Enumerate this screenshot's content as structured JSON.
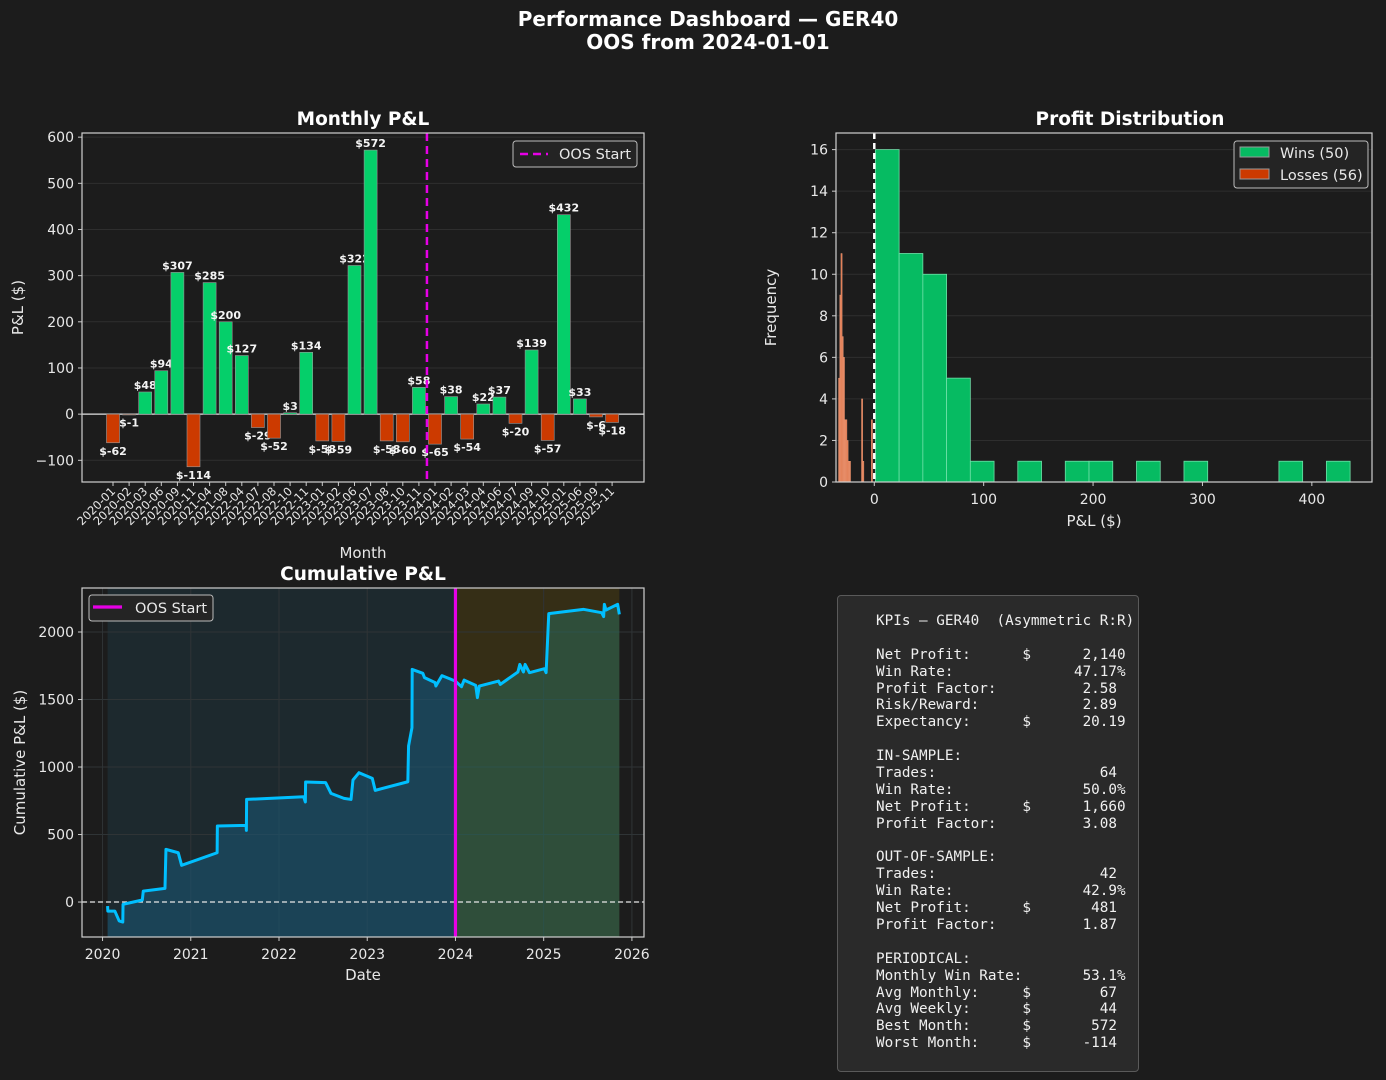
{
  "title": "Performance Dashboard — GER40",
  "subtitle": "OOS from 2024-01-01",
  "colors": {
    "background": "#1c1c1c",
    "win": "#05cf6a",
    "loss": "#cc3a00",
    "win_hist": "#06bb62",
    "loss_hist": "#e07a50",
    "oos": "#e600e6",
    "equity": "#00bfff"
  },
  "chart_data": [
    {
      "type": "bar",
      "title": "Monthly P&L",
      "xlabel": "Month",
      "ylabel": "P&L ($)",
      "ylim": [
        -147,
        609
      ],
      "yticks": [
        -100,
        0,
        100,
        200,
        300,
        400,
        500,
        600
      ],
      "categories": [
        "2020-01",
        "2020-02",
        "2020-03",
        "2020-06",
        "2020-09",
        "2020-11",
        "2021-04",
        "2021-08",
        "2022-04",
        "2022-07",
        "2022-08",
        "2022-10",
        "2022-11",
        "2023-01",
        "2023-02",
        "2023-06",
        "2023-07",
        "2023-08",
        "2023-10",
        "2023-11",
        "2024-01",
        "2024-02",
        "2024-03",
        "2024-04",
        "2024-06",
        "2024-07",
        "2024-09",
        "2024-10",
        "2025-01",
        "2025-06",
        "2025-09",
        "2025-11"
      ],
      "values": [
        -62,
        -1,
        48,
        94,
        307,
        -114,
        285,
        200,
        127,
        -29,
        -52,
        3,
        134,
        -58,
        -59,
        322,
        572,
        -58,
        -60,
        58,
        -65,
        38,
        -54,
        22,
        37,
        -20,
        139,
        -57,
        432,
        33,
        -6,
        -18
      ],
      "labels": [
        "$-62",
        "$-1",
        "$48",
        "$94",
        "$307",
        "$-114",
        "$285",
        "$200",
        "$127",
        "$-29",
        "$-52",
        "$3",
        "$134",
        "$-58",
        "$-59",
        "$322",
        "$572",
        "$-58",
        "$-60",
        "$58",
        "$-65",
        "$38",
        "$-54",
        "$22",
        "$37",
        "$-20",
        "$139",
        "$-57",
        "$432",
        "$33",
        "$-6",
        "$-18"
      ],
      "oos_start_between": [
        "2023-11",
        "2024-01"
      ],
      "legend": {
        "entries": [
          "OOS Start"
        ],
        "placement": "upper right"
      },
      "grid": true
    },
    {
      "type": "histogram",
      "title": "Profit Distribution",
      "xlabel": "P&L ($)",
      "ylabel": "Frequency",
      "xlim": [
        -35,
        455
      ],
      "ylim": [
        0,
        16.8
      ],
      "xticks": [
        0,
        100,
        200,
        300,
        400
      ],
      "yticks": [
        0,
        2,
        4,
        6,
        8,
        10,
        12,
        14,
        16
      ],
      "series": [
        {
          "name": "Wins (50)",
          "bin_width": 21.7,
          "bins": [
            [
              1,
              16
            ],
            [
              22.7,
              11
            ],
            [
              44.4,
              10
            ],
            [
              66.1,
              5
            ],
            [
              87.8,
              1
            ],
            [
              131.2,
              1
            ],
            [
              174.6,
              1
            ],
            [
              196.3,
              1
            ],
            [
              239.7,
              1
            ],
            [
              283.1,
              1
            ],
            [
              369.9,
              1
            ],
            [
              413.3,
              1
            ]
          ]
        },
        {
          "name": "Losses (56)",
          "bin_width": 1.1,
          "bins": [
            [
              -32.7,
              5
            ],
            [
              -31.6,
              9
            ],
            [
              -30.5,
              11
            ],
            [
              -29.4,
              7
            ],
            [
              -28.3,
              6
            ],
            [
              -27.2,
              3
            ],
            [
              -26.1,
              3
            ],
            [
              -25.0,
              2
            ],
            [
              -23.9,
              1
            ],
            [
              -22.8,
              1
            ],
            [
              -11.7,
              4
            ],
            [
              -10.6,
              1
            ],
            [
              -2.7,
              3
            ]
          ]
        }
      ],
      "zero_line": 0,
      "legend": {
        "placement": "upper right"
      },
      "grid": true
    },
    {
      "type": "line",
      "title": "Cumulative P&L",
      "xlabel": "Date",
      "ylabel": "Cumulative P&L ($)",
      "xlim": [
        "2019-10-08",
        "2026-02-20"
      ],
      "ylim": [
        -259,
        2326
      ],
      "xticks": [
        "2020",
        "2021",
        "2022",
        "2023",
        "2024",
        "2025",
        "2026"
      ],
      "yticks": [
        0,
        500,
        1000,
        1500,
        2000
      ],
      "oos_start": "2024-01-01",
      "legend": {
        "entries": [
          "OOS Start"
        ],
        "placement": "upper left"
      },
      "points": [
        [
          "2020-01-22",
          -30
        ],
        [
          "2020-01-23",
          -67
        ],
        [
          "2020-02-21",
          -67
        ],
        [
          "2020-03-10",
          -140
        ],
        [
          "2020-03-25",
          -148
        ],
        [
          "2020-03-26",
          -17
        ],
        [
          "2020-06-14",
          15
        ],
        [
          "2020-06-18",
          81
        ],
        [
          "2020-09-16",
          101
        ],
        [
          "2020-09-20",
          390
        ],
        [
          "2020-11-10",
          365
        ],
        [
          "2020-11-24",
          272
        ],
        [
          "2021-04-20",
          365
        ],
        [
          "2021-04-21",
          563
        ],
        [
          "2021-08-18",
          568
        ],
        [
          "2021-08-19",
          531
        ],
        [
          "2021-08-20",
          760
        ],
        [
          "2022-04-13",
          780
        ],
        [
          "2022-04-20",
          741
        ],
        [
          "2022-04-21",
          889
        ],
        [
          "2022-07-13",
          884
        ],
        [
          "2022-08-04",
          805
        ],
        [
          "2022-09-27",
          768
        ],
        [
          "2022-10-26",
          760
        ],
        [
          "2022-11-03",
          904
        ],
        [
          "2022-11-28",
          958
        ],
        [
          "2023-01-22",
          916
        ],
        [
          "2023-02-03",
          827
        ],
        [
          "2023-06-18",
          891
        ],
        [
          "2023-06-21",
          1156
        ],
        [
          "2023-07-05",
          1291
        ],
        [
          "2023-07-06",
          1723
        ],
        [
          "2023-08-19",
          1694
        ],
        [
          "2023-08-26",
          1662
        ],
        [
          "2023-10-09",
          1625
        ],
        [
          "2023-10-12",
          1600
        ],
        [
          "2023-11-06",
          1677
        ],
        [
          "2023-12-31",
          1637
        ],
        [
          "2024-01-26",
          1595
        ],
        [
          "2024-02-06",
          1644
        ],
        [
          "2024-03-25",
          1605
        ],
        [
          "2024-04-01",
          1514
        ],
        [
          "2024-04-09",
          1600
        ],
        [
          "2024-06-28",
          1637
        ],
        [
          "2024-07-05",
          1612
        ],
        [
          "2024-09-16",
          1704
        ],
        [
          "2024-09-24",
          1760
        ],
        [
          "2024-10-09",
          1704
        ],
        [
          "2024-10-16",
          1760
        ],
        [
          "2024-11-03",
          1699
        ],
        [
          "2025-01-04",
          1728
        ],
        [
          "2025-01-11",
          1699
        ],
        [
          "2025-01-22",
          2136
        ],
        [
          "2025-06-14",
          2168
        ],
        [
          "2025-08-29",
          2143
        ],
        [
          "2025-09-06",
          2114
        ],
        [
          "2025-09-09",
          2205
        ],
        [
          "2025-09-16",
          2163
        ],
        [
          "2025-11-03",
          2205
        ],
        [
          "2025-11-10",
          2131
        ]
      ],
      "grid": true
    }
  ],
  "kpis": {
    "header": "KPIs — GER40  (Asymmetric R:R)",
    "sections": [
      {
        "title": "",
        "rows": [
          {
            "label": "Net Profit:",
            "currency": "$",
            "value": "2,140"
          },
          {
            "label": "Win Rate:",
            "currency": "",
            "value": "47.17%"
          },
          {
            "label": "Profit Factor:",
            "currency": "",
            "value": "2.58 "
          },
          {
            "label": "Risk/Reward:",
            "currency": "",
            "value": "2.89 "
          },
          {
            "label": "Expectancy:",
            "currency": "$",
            "value": "20.19"
          }
        ]
      },
      {
        "title": "IN-SAMPLE:",
        "rows": [
          {
            "label": "Trades:",
            "currency": "",
            "value": "64 "
          },
          {
            "label": "Win Rate:",
            "currency": "",
            "value": "50.0%"
          },
          {
            "label": "Net Profit:",
            "currency": "$",
            "value": "1,660"
          },
          {
            "label": "Profit Factor:",
            "currency": "",
            "value": "3.08 "
          }
        ]
      },
      {
        "title": "OUT-OF-SAMPLE:",
        "rows": [
          {
            "label": "Trades:",
            "currency": "",
            "value": "42 "
          },
          {
            "label": "Win Rate:",
            "currency": "",
            "value": "42.9%"
          },
          {
            "label": "Net Profit:",
            "currency": "$",
            "value": "481 "
          },
          {
            "label": "Profit Factor:",
            "currency": "",
            "value": "1.87 "
          }
        ]
      },
      {
        "title": "PERIODICAL:",
        "rows": [
          {
            "label": "Monthly Win Rate:",
            "currency": "",
            "value": "53.1%"
          },
          {
            "label": "Avg Monthly:",
            "currency": "$",
            "value": "67 "
          },
          {
            "label": "Avg Weekly:",
            "currency": "$",
            "value": "44 "
          },
          {
            "label": "Best Month:",
            "currency": "$",
            "value": "572 "
          },
          {
            "label": "Worst Month:",
            "currency": "$",
            "value": "-114 "
          }
        ]
      }
    ]
  }
}
